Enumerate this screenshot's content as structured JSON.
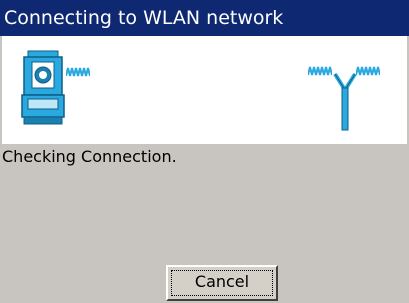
{
  "window": {
    "title": "Connecting to WLAN network"
  },
  "animation": {
    "left_device_icon": "total-station-icon",
    "right_device_icon": "wlan-antenna-icon",
    "signal_icon": "signal-wave-icon",
    "accent_color": "#2aa9e0"
  },
  "status": {
    "text": "Checking Connection."
  },
  "buttons": {
    "cancel_label": "Cancel"
  }
}
